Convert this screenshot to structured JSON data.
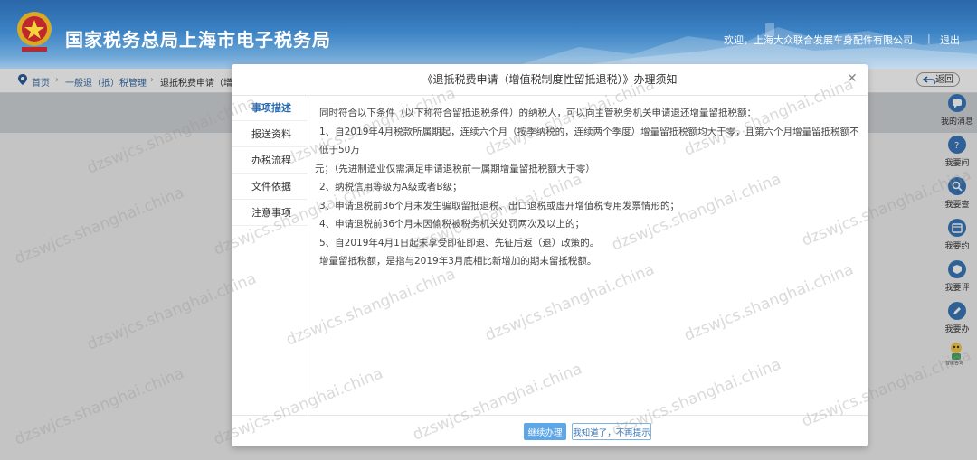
{
  "header": {
    "site_title": "国家税务总局上海市电子税务局",
    "welcome": "欢迎，上海大众联合发展车身配件有限公司",
    "separator": "|",
    "logout": "退出"
  },
  "breadcrumb": {
    "items": [
      "首页",
      "一般退（抵）税管理",
      "退抵税费申请（增"
    ],
    "back_label": "返回"
  },
  "right_toolbar": [
    {
      "label": "我的消息",
      "icon": "chat-bubble-icon"
    },
    {
      "label": "我要问",
      "icon": "question-icon"
    },
    {
      "label": "我要查",
      "icon": "search-icon"
    },
    {
      "label": "我要约",
      "icon": "calendar-icon"
    },
    {
      "label": "我要评",
      "icon": "rating-icon"
    },
    {
      "label": "我要办",
      "icon": "pen-icon"
    }
  ],
  "robot_label": "智能咨询",
  "watermark": "dzswjcs.shanghai.china",
  "modal": {
    "title": "《退抵税费申请（增值税制度性留抵退税）》办理须知",
    "tabs": [
      "事项描述",
      "报送资料",
      "办税流程",
      "文件依据",
      "注意事项"
    ],
    "active_tab": 0,
    "content": [
      "同时符合以下条件（以下称符合留抵退税条件）的纳税人，可以向主管税务机关申请退还增量留抵税额：",
      "1、自2019年4月税款所属期起，连续六个月（按季纳税的，连续两个季度）增量留抵税额均大于零，且第六个月增量留抵税额不低于50万",
      "元；（先进制造业仅需满足申请退税前一属期增量留抵税额大于零）",
      "2、纳税信用等级为A级或者B级；",
      "3、申请退税前36个月未发生骗取留抵退税、出口退税或虚开增值税专用发票情形的；",
      "4、申请退税前36个月未因偷税被税务机关处罚两次及以上的；",
      "5、自2019年4月1日起未享受即征即退、先征后返（退）政策的。",
      "增量留抵税额，是指与2019年3月底相比新增加的期末留抵税额。"
    ],
    "continue_label": "继续办理",
    "dismiss_label": "我知道了，不再提示"
  },
  "colors": {
    "primary": "#5ea6e6",
    "header_blue": "#3b82c4",
    "tool_blue": "#3a77b8"
  }
}
